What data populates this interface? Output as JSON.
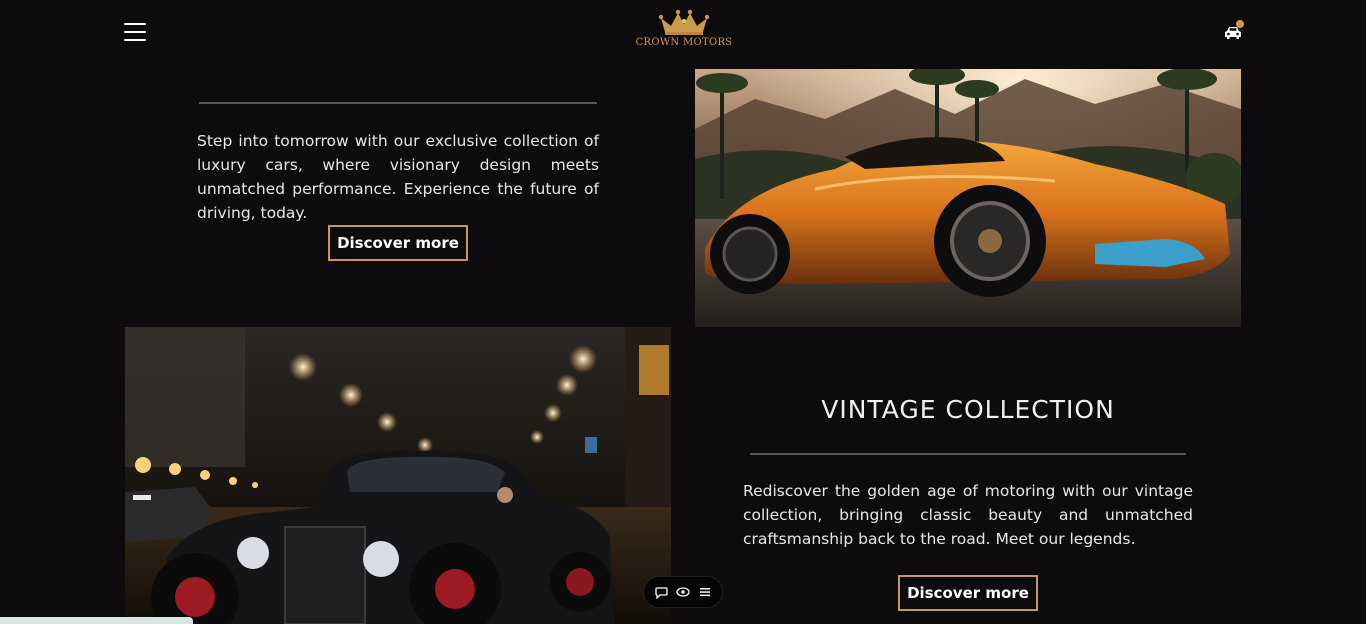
{
  "header": {
    "brand": "CROWN MOTORS",
    "menu_icon": "hamburger-menu-icon",
    "logo_icon": "crown-icon",
    "garage_icon": "car-icon",
    "accent": "#c99b4a"
  },
  "sections": [
    {
      "description": "Step into tomorrow with our exclusive collection of luxury cars, where visionary design meets unmatched performance. Experience the future of driving, today.",
      "button_label": "Discover more",
      "image": "orange-supercar-photo"
    },
    {
      "title": "VINTAGE COLLECTION",
      "description": "Rediscover the golden age of motoring with our vintage collection, bringing classic beauty and unmatched craftsmanship back to the road. Meet our legends.",
      "button_label": "Discover more",
      "image": "vintage-hotrod-photo"
    }
  ],
  "widget": {
    "icons": [
      "chat-bubble-icon",
      "eye-icon",
      "list-icon"
    ]
  },
  "colors": {
    "background": "#0d0b0e",
    "text": "#e9e6e6",
    "accent": "#c99b4a"
  }
}
